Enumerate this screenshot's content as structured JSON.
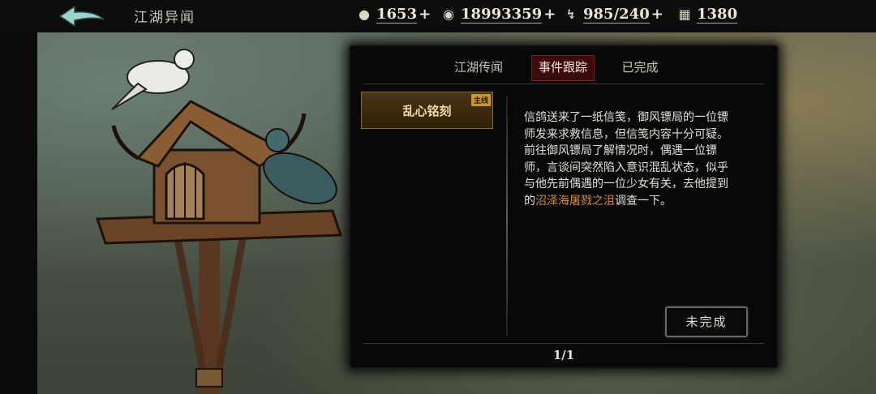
{
  "header": {
    "title": "江湖异闻",
    "resources": [
      {
        "icon": "ingot-icon",
        "value": "1653",
        "plus": true
      },
      {
        "icon": "coin-icon",
        "value": "18993359",
        "plus": true
      },
      {
        "icon": "energy-icon",
        "value": "985/240",
        "plus": true
      },
      {
        "icon": "ticket-icon",
        "value": "1380",
        "plus": false
      }
    ]
  },
  "tabs": [
    {
      "label": "江湖传闻",
      "active": false
    },
    {
      "label": "事件跟踪",
      "active": true
    },
    {
      "label": "已完成",
      "active": false
    }
  ],
  "quest": {
    "name": "乱心铭刻",
    "badge": "主线"
  },
  "description": {
    "p1": "信鸽送来了一纸信笺，御风镖局的一位镖师发来求救信息，但信笺内容十分可疑。",
    "p2_before": "前往御风镖局了解情况时，偶遇一位镖师，言谈间突然陷入意识混乱状态，似乎与他先前偶遇的一位少女有关，去他提到的",
    "p2_highlight": "沼泽海屠戮之沮",
    "p2_after": "调查一下。"
  },
  "status_button": "未完成",
  "pagination": "1/1",
  "colors": {
    "highlight": "#d28a3e",
    "active_tab": "#3d0b0b",
    "quest_bg": "#4a3514"
  }
}
